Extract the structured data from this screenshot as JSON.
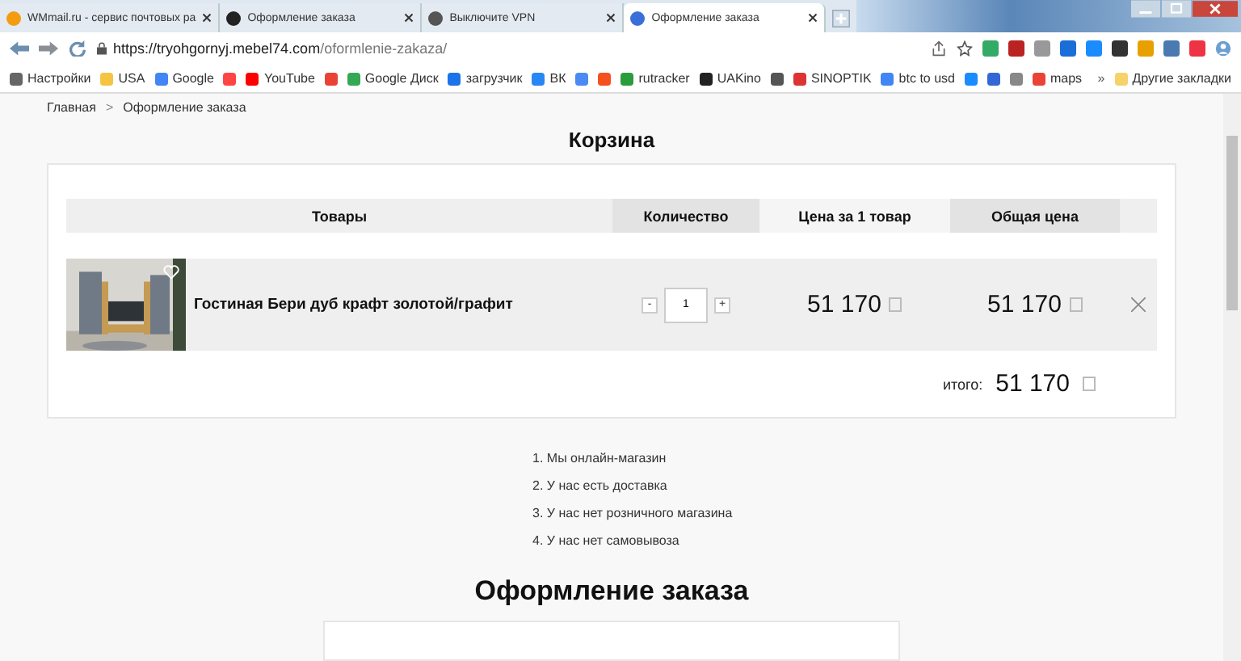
{
  "browser": {
    "tabs": [
      {
        "title": "WMmail.ru - сервис почтовых ра",
        "selected": false
      },
      {
        "title": "Оформление заказа",
        "selected": false
      },
      {
        "title": "Выключите VPN",
        "selected": false
      },
      {
        "title": "Оформление заказа",
        "selected": true
      }
    ],
    "address": {
      "host": "https://tryohgornyj.mebel74.com",
      "path": "/oformlenie-zakaza/"
    },
    "bookmarks": [
      {
        "kind": "link",
        "label": "Настройки"
      },
      {
        "kind": "link",
        "label": "USA"
      },
      {
        "kind": "link",
        "label": "Google"
      },
      {
        "kind": "icon"
      },
      {
        "kind": "link",
        "label": "YouTube"
      },
      {
        "kind": "icon"
      },
      {
        "kind": "link",
        "label": "Google Диск"
      },
      {
        "kind": "link",
        "label": "загрузчик"
      },
      {
        "kind": "link",
        "label": "ВК"
      },
      {
        "kind": "icon"
      },
      {
        "kind": "icon"
      },
      {
        "kind": "link",
        "label": "rutracker"
      },
      {
        "kind": "link",
        "label": "UAKino"
      },
      {
        "kind": "icon"
      },
      {
        "kind": "link",
        "label": "SINOPTIK"
      },
      {
        "kind": "link",
        "label": "btc to usd"
      },
      {
        "kind": "icon"
      },
      {
        "kind": "icon"
      },
      {
        "kind": "icon"
      },
      {
        "kind": "link",
        "label": "maps"
      }
    ],
    "more_bookmarks": "»",
    "other_bookmarks": "Другие закладки"
  },
  "breadcrumbs": [
    {
      "label": "Главная"
    },
    {
      "label": "Оформление заказа"
    }
  ],
  "breadcrumb_separator": ">",
  "cart": {
    "title": "Корзина",
    "columns": [
      "Товары",
      "Количество",
      "Цена за 1 товар",
      "Общая цена"
    ],
    "rows": [
      {
        "name": "Гостиная Бери дуб крафт золотой/графит",
        "quantity": "1",
        "minus": "-",
        "plus": "+",
        "price": "51 170",
        "total": "51 170"
      }
    ],
    "total_label": "итого:",
    "total": "51 170"
  },
  "notes": [
    {
      "number": "1.",
      "text": "Мы онлайн-магазин"
    },
    {
      "number": "2.",
      "text": "У нас есть доставка"
    },
    {
      "number": "3.",
      "text": "У нас нет розничного магазина"
    },
    {
      "number": "4.",
      "text": "У нас нет самовывоза"
    }
  ],
  "order_title": "Оформление заказа"
}
